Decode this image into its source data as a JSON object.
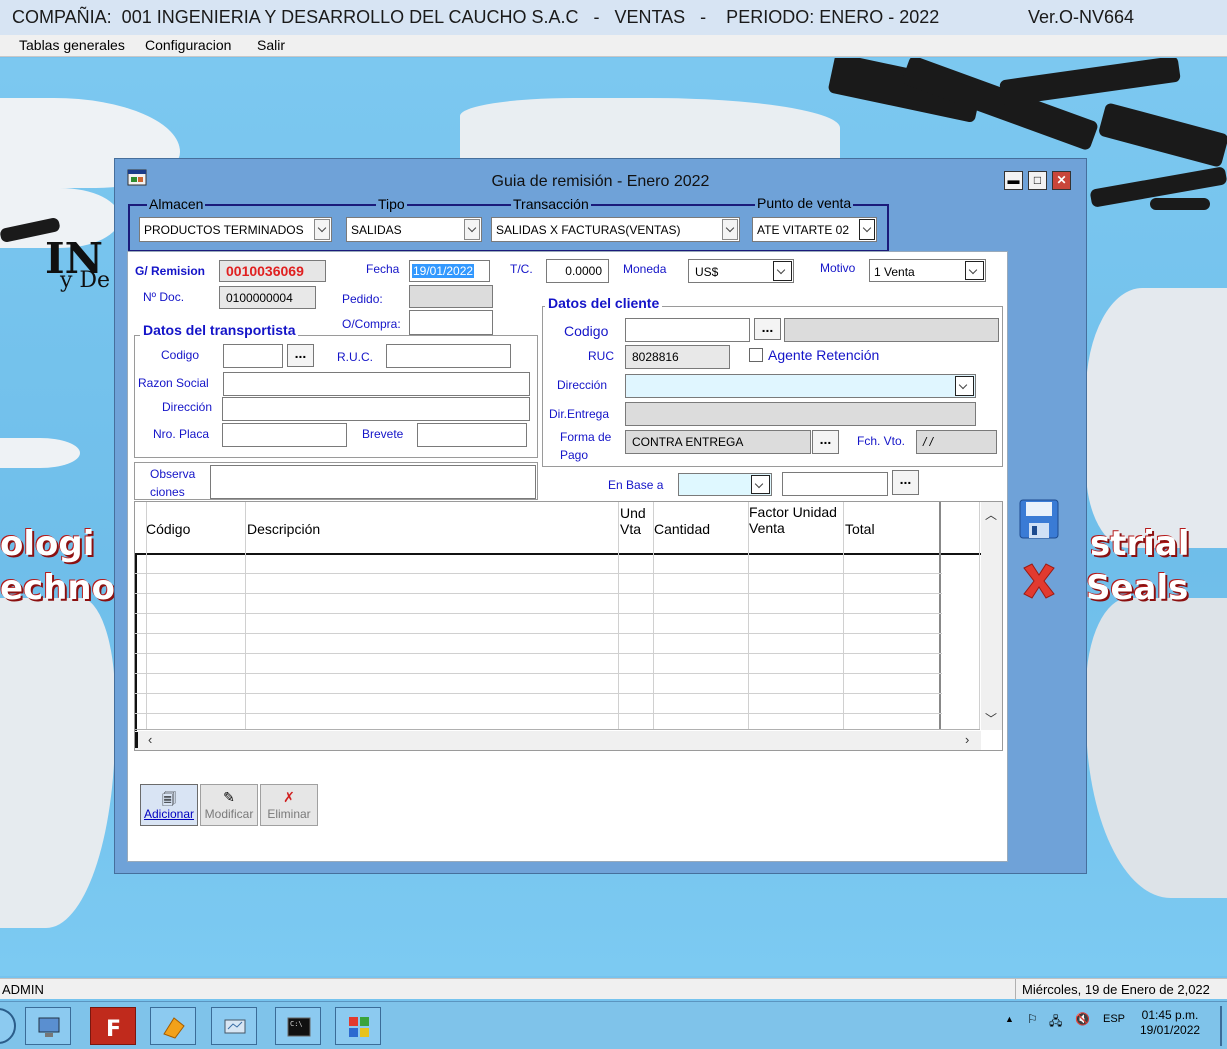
{
  "app": {
    "title": "COMPAÑIA:  001 INGENIERIA Y DESARROLLO DEL CAUCHO S.A.C   -   VENTAS   -    PERIODO: ENERO - 2022",
    "version": "Ver.O-NV664"
  },
  "menu": {
    "items": [
      {
        "label": "Tablas generales"
      },
      {
        "label": "Configuracion"
      },
      {
        "label": "Salir"
      }
    ]
  },
  "background": {
    "logo_part1": "IN",
    "logo_part2": "y De",
    "slogan_left_1": "ologi",
    "slogan_left_2": "echno",
    "slogan_right_1": "strial",
    "slogan_right_2": "Seals"
  },
  "dialog": {
    "title": "Guia de remisión - Enero 2022",
    "minimize": "▬",
    "maximize": "□",
    "close": "✕"
  },
  "top": {
    "almacen_label": "Almacen",
    "almacen_value": "PRODUCTOS TERMINADOS",
    "tipo_label": "Tipo",
    "tipo_value": "SALIDAS",
    "transaccion_label": "Transacción",
    "transaccion_value": "SALIDAS X FACTURAS(VENTAS)",
    "punto_label": "Punto de venta",
    "punto_value": "ATE VITARTE 02"
  },
  "doc": {
    "remision_label": "G/ Remision",
    "remision_value": "0010036069",
    "ndoc_label": "Nº Doc.",
    "ndoc_value": "0100000004",
    "fecha_label": "Fecha",
    "fecha_value": "19/01/2022",
    "pedido_label": "Pedido:",
    "pedido_value": "",
    "ocompra_label": "O/Compra:",
    "ocompra_value": "",
    "tc_label": "T/C.",
    "tc_value": "0.0000",
    "moneda_label": "Moneda",
    "moneda_value": "US$",
    "motivo_label": "Motivo",
    "motivo_value": "1 Venta"
  },
  "transportista": {
    "title": "Datos del transportista",
    "codigo_label": "Codigo",
    "codigo_value": "",
    "ruc_label": "R.U.C.",
    "ruc_value": "",
    "razon_label": "Razon Social",
    "razon_value": "",
    "direccion_label": "Dirección",
    "direccion_value": "",
    "placa_label": "Nro. Placa",
    "placa_value": "",
    "brevete_label": "Brevete",
    "brevete_value": ""
  },
  "cliente": {
    "title": "Datos del cliente",
    "codigo_label": "Codigo",
    "codigo_value": "",
    "nombre_value": "",
    "ruc_label": "RUC",
    "ruc_value": "8028816",
    "agente_label": "Agente Retención",
    "agente_checked": false,
    "direccion_label": "Dirección",
    "direccion_value": "",
    "dir_entrega_label": "Dir.Entrega",
    "dir_entrega_value": "",
    "forma_label_1": "Forma de",
    "forma_label_2": "Pago",
    "forma_value": "CONTRA ENTREGA",
    "fch_vto_label": "Fch. Vto.",
    "fch_vto_value": "/ /"
  },
  "misc": {
    "observa_label_1": "Observa",
    "observa_label_2": "ciones",
    "observa_value": "",
    "en_base_label": "En Base a",
    "en_base_value": "",
    "en_base_extra": "",
    "dots": "..."
  },
  "grid": {
    "columns": [
      {
        "label": "Código"
      },
      {
        "label": "Descripción"
      },
      {
        "label": "Und\nVta"
      },
      {
        "label": "Cantidad"
      },
      {
        "label": "Factor Unidad\nVenta"
      },
      {
        "label": "Total"
      }
    ]
  },
  "actions": {
    "adicionar": "Adicionar",
    "modificar": "Modificar",
    "eliminar": "Eliminar"
  },
  "status": {
    "user": "ADMIN",
    "date_long": "Miércoles, 19 de Enero de 2,022"
  },
  "taskbar": {
    "lang": "ESP",
    "time": "01:45 p.m.",
    "date": "19/01/2022"
  }
}
